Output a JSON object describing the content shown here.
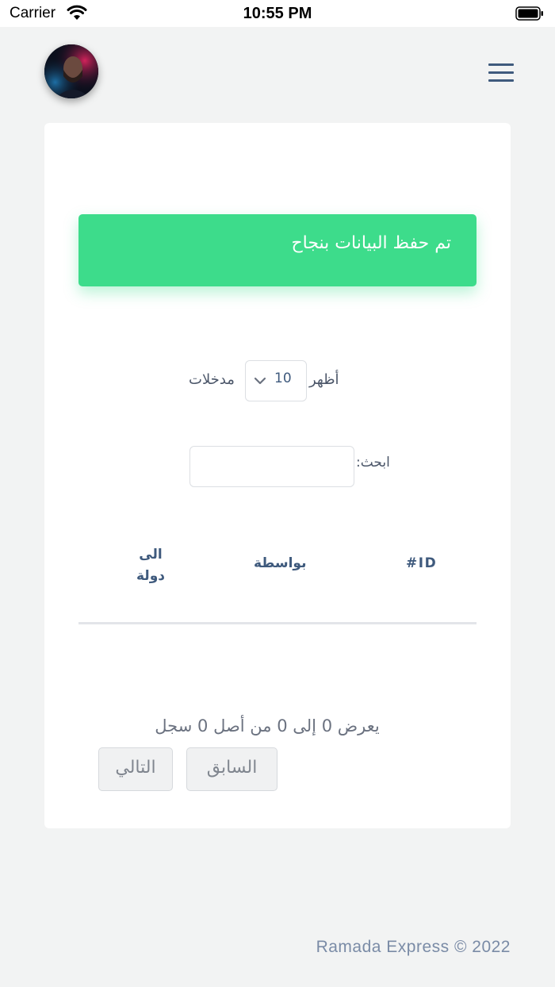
{
  "status_bar": {
    "carrier": "Carrier",
    "time": "10:55 PM"
  },
  "header": {
    "avatar_icon": "user-avatar",
    "menu_icon": "hamburger-menu-icon"
  },
  "alert": {
    "message": "تم حفظ البيانات بنجاح",
    "color": "#3ddc8b"
  },
  "length_menu": {
    "show_label": "أظهر",
    "selected_value": "10",
    "entries_label": "مدخلات"
  },
  "search": {
    "label": "ابحث:",
    "value": ""
  },
  "table": {
    "columns": [
      "#ID",
      "بواسطة",
      "الى دولة"
    ],
    "rows": []
  },
  "pagination": {
    "info": "يعرض 0 إلى 0 من أصل 0 سجل",
    "previous_label": "السابق",
    "next_label": "التالي"
  },
  "footer": {
    "text": "Ramada Express © 2022"
  },
  "colors": {
    "accent": "#3f5a7d",
    "background": "#f2f3f3",
    "success": "#3ddc8b"
  }
}
